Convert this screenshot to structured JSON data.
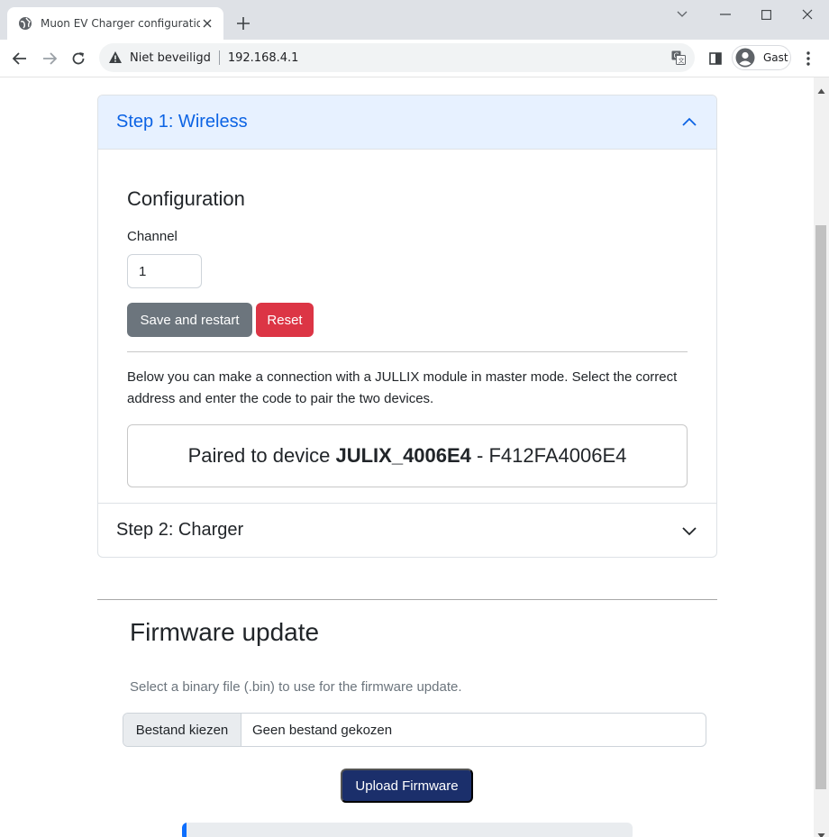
{
  "browser": {
    "tab_title": "Muon EV Charger configuration",
    "security_label": "Niet beveiligd",
    "url": "192.168.4.1",
    "profile_label": "Gast"
  },
  "accordion": {
    "step1_title": "Step 1: Wireless",
    "step2_title": "Step 2: Charger"
  },
  "config": {
    "title": "Configuration",
    "channel_label": "Channel",
    "channel_value": "1",
    "save_label": "Save and restart",
    "reset_label": "Reset",
    "info_text": "Below you can make a connection with a JULLIX module in master mode. Select the correct address and enter the code to pair the two devices.",
    "paired_prefix": "Paired to device ",
    "paired_device": "JULIX_4006E4",
    "paired_suffix": " - F412FA4006E4"
  },
  "firmware": {
    "title": "Firmware update",
    "help_text": "Select a binary file (.bin) to use for the firmware update.",
    "file_button_label": "Bestand kiezen",
    "file_name": "Geen bestand gekozen",
    "upload_label": "Upload Firmware",
    "progress_percent": 1
  },
  "colors": {
    "accordion_active_bg": "#e7f1ff",
    "accordion_active_text": "#0c63e4",
    "save_button": "#6c757d",
    "reset_button": "#dc3545",
    "upload_button": "#1b2f6b",
    "progress": "#0d6efd"
  },
  "icons": {
    "favicon": "globe-icon",
    "warning": "warning-icon",
    "translate": "translate-icon",
    "profile": "account-circle-icon"
  }
}
